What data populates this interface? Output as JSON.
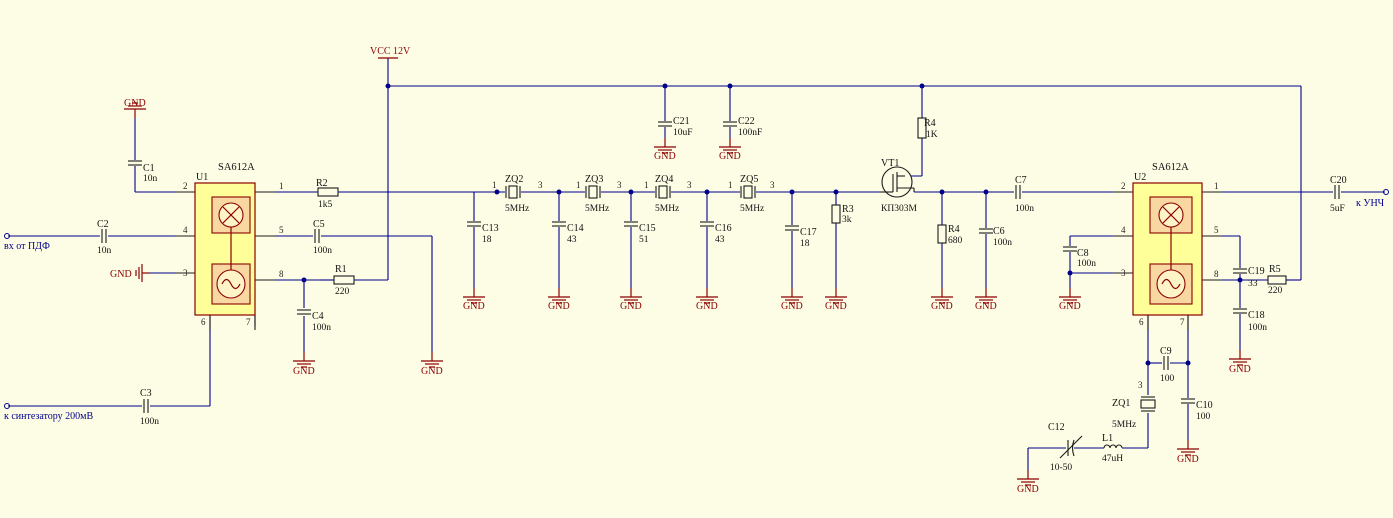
{
  "supply": {
    "vcc_label": "VCC 12V"
  },
  "ground_label": "GND",
  "ports": {
    "input_left": "вх от ПДФ",
    "synth_input": "к синтезатору 200мВ",
    "output_right": "к УНЧ"
  },
  "chips": [
    {
      "ref": "U1",
      "type": "SA612A",
      "pins": [
        "1",
        "2",
        "3",
        "4",
        "5",
        "6",
        "7",
        "8"
      ]
    },
    {
      "ref": "U2",
      "type": "SA612A",
      "pins": [
        "1",
        "2",
        "3",
        "4",
        "5",
        "6",
        "7",
        "8"
      ]
    }
  ],
  "capacitors": [
    {
      "ref": "C1",
      "value": "10n"
    },
    {
      "ref": "C2",
      "value": "10n"
    },
    {
      "ref": "C3",
      "value": "100n"
    },
    {
      "ref": "C4",
      "value": "100n"
    },
    {
      "ref": "C5",
      "value": "100n"
    },
    {
      "ref": "C6",
      "value": "100n"
    },
    {
      "ref": "C7",
      "value": "100n"
    },
    {
      "ref": "C8",
      "value": "100n"
    },
    {
      "ref": "C9",
      "value": "100"
    },
    {
      "ref": "C10",
      "value": "100"
    },
    {
      "ref": "C12",
      "value": "10-50"
    },
    {
      "ref": "C13",
      "value": "18"
    },
    {
      "ref": "C14",
      "value": "43"
    },
    {
      "ref": "C15",
      "value": "51"
    },
    {
      "ref": "C16",
      "value": "43"
    },
    {
      "ref": "C17",
      "value": "18"
    },
    {
      "ref": "C18",
      "value": "100n"
    },
    {
      "ref": "C19",
      "value": "33"
    },
    {
      "ref": "C20",
      "value": "5uF"
    },
    {
      "ref": "C21",
      "value": "10uF"
    },
    {
      "ref": "C22",
      "value": "100nF"
    }
  ],
  "resistors": [
    {
      "ref": "R1",
      "value": "220"
    },
    {
      "ref": "R2",
      "value": "1k5"
    },
    {
      "ref": "R3",
      "value": "3k"
    },
    {
      "ref": "R4",
      "value": "680"
    },
    {
      "ref": "R4",
      "value": "1K"
    },
    {
      "ref": "R5",
      "value": "220"
    }
  ],
  "crystals": [
    {
      "ref": "ZQ1",
      "value": "5MHz"
    },
    {
      "ref": "ZQ2",
      "value": "5MHz"
    },
    {
      "ref": "ZQ3",
      "value": "5MHz"
    },
    {
      "ref": "ZQ4",
      "value": "5MHz"
    },
    {
      "ref": "ZQ5",
      "value": "5MHz"
    }
  ],
  "crystal_pins": {
    "left": "1",
    "right": "3"
  },
  "inductor": {
    "ref": "L1",
    "value": "47uH"
  },
  "transistor": {
    "ref": "VT1",
    "value": "КП303М"
  }
}
